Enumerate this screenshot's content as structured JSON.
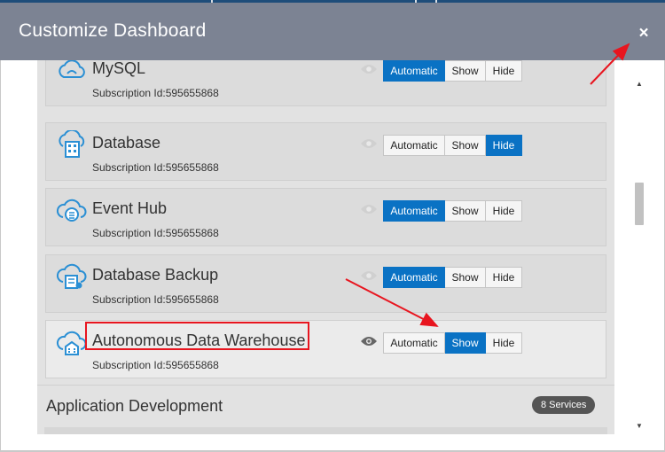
{
  "dialog": {
    "title": "Customize Dashboard",
    "close_label": "×"
  },
  "services": [
    {
      "name": "MySQL",
      "subscription": "Subscription Id:595655868",
      "selected": "Automatic",
      "icon": "cloud-mysql-icon"
    },
    {
      "name": "Database",
      "subscription": "Subscription Id:595655868",
      "selected": "Hide",
      "icon": "cloud-database-icon"
    },
    {
      "name": "Event Hub",
      "subscription": "Subscription Id:595655868",
      "selected": "Automatic",
      "icon": "cloud-event-hub-icon"
    },
    {
      "name": "Database Backup",
      "subscription": "Subscription Id:595655868",
      "selected": "Automatic",
      "icon": "cloud-database-backup-icon"
    },
    {
      "name": "Autonomous Data Warehouse",
      "subscription": "Subscription Id:595655868",
      "selected": "Show",
      "icon": "cloud-data-warehouse-icon"
    }
  ],
  "buttons": {
    "automatic": "Automatic",
    "show": "Show",
    "hide": "Hide"
  },
  "section": {
    "label": "Application Development",
    "badge": "8 Services"
  },
  "colors": {
    "header": "#7c8393",
    "accent": "#0a72c4",
    "annotation": "#e8151f"
  }
}
